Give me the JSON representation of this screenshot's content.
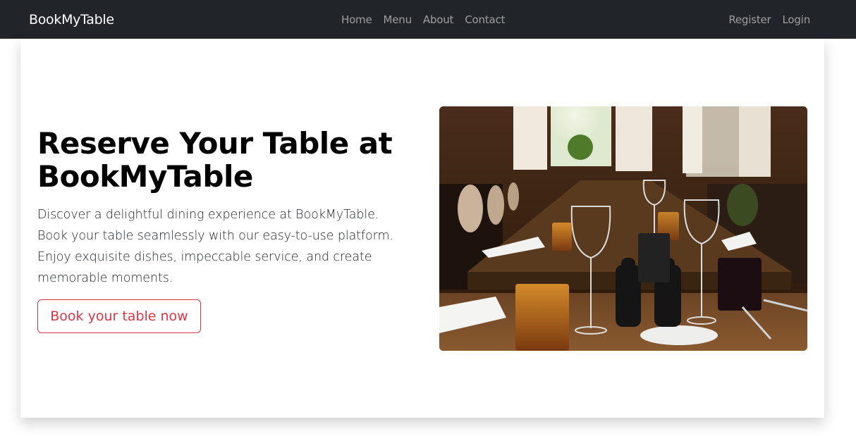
{
  "navbar": {
    "brand": "BookMyTable",
    "links": [
      "Home",
      "Menu",
      "About",
      "Contact"
    ],
    "auth": {
      "register": "Register",
      "login": "Login"
    }
  },
  "hero": {
    "title": "Reserve Your Table at BookMyTable",
    "text": "Discover a delightful dining experience at BookMyTable. Book your table seamlessly with our easy-to-use platform. Enjoy exquisite dishes, impeccable service, and create memorable moments.",
    "cta": "Book your table now"
  },
  "colors": {
    "navbar_bg": "#212529",
    "cta_accent": "#dc3545"
  }
}
